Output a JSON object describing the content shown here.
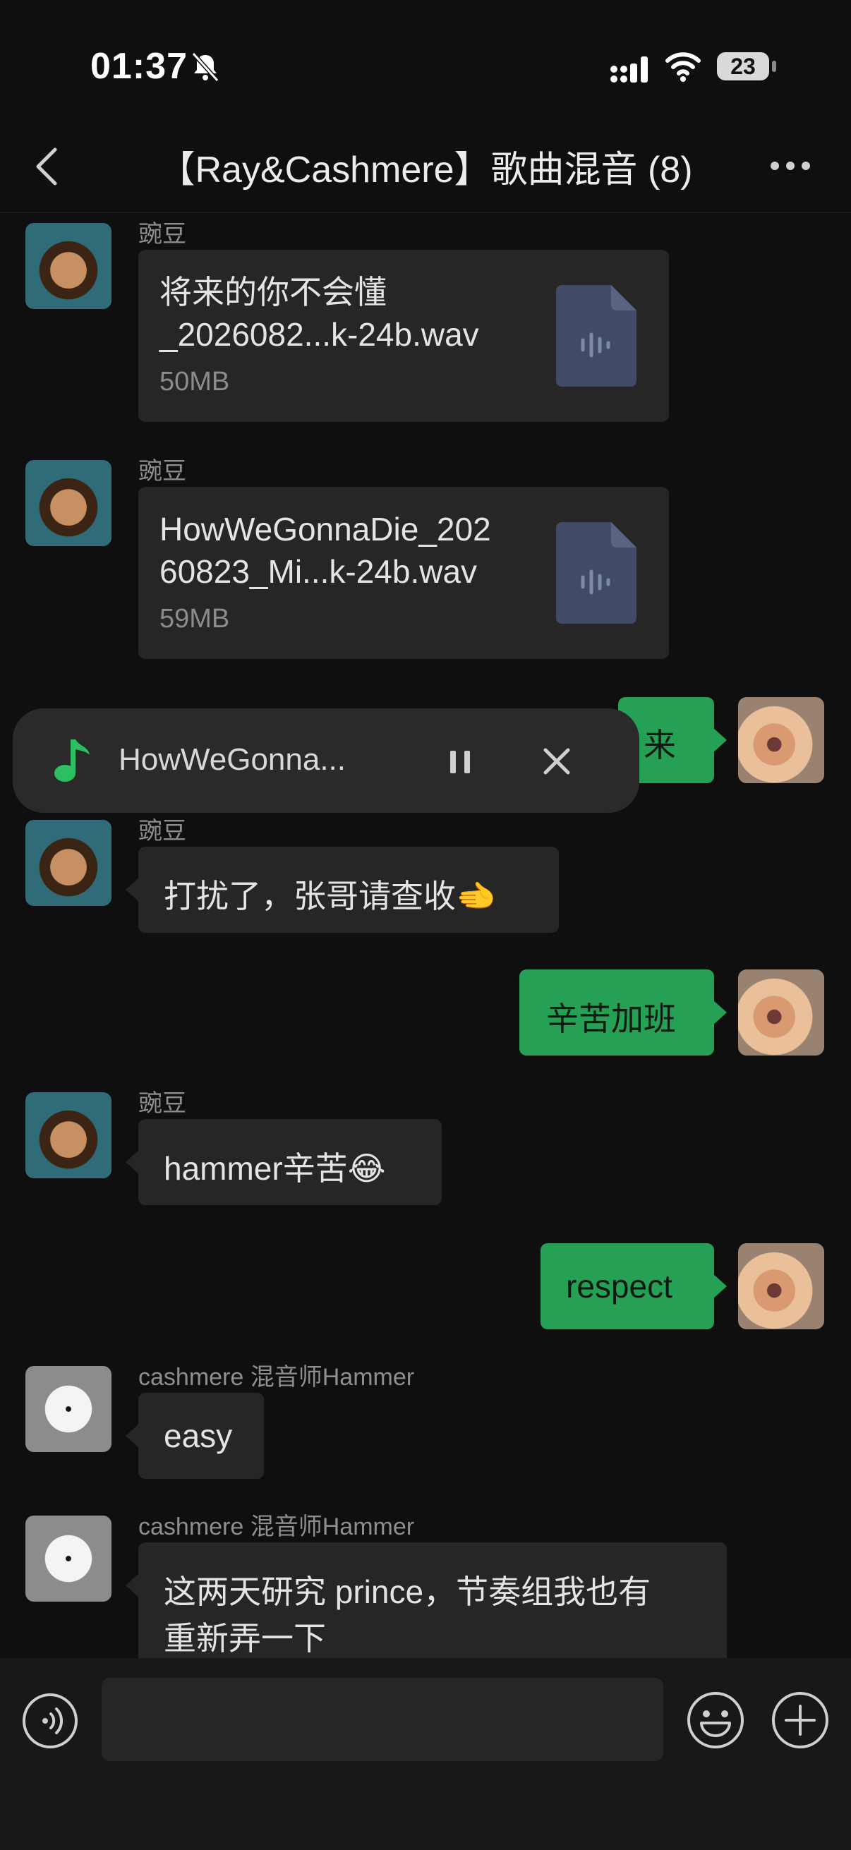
{
  "status_bar": {
    "time": "01:37",
    "battery": "23"
  },
  "header": {
    "title": "【Ray&Cashmere】歌曲混音 (8)"
  },
  "messages": {
    "m1": {
      "sender": "豌豆",
      "file_name_line1": "将来的你不会懂",
      "file_name_line2": "_2026082...k-24b.wav",
      "file_size": "50MB"
    },
    "m2": {
      "sender": "豌豆",
      "file_name_line1": "HowWeGonnaDie_202",
      "file_name_line2": "60823_Mi...k-24b.wav",
      "file_size": "59MB"
    },
    "m3": {
      "text": "来"
    },
    "m4": {
      "sender": "豌豆",
      "text": "打扰了，张哥请查收🫲"
    },
    "m5": {
      "text": "辛苦加班"
    },
    "m6": {
      "sender": "豌豆",
      "text": "hammer辛苦😂"
    },
    "m7": {
      "text": "respect"
    },
    "m8": {
      "sender": "cashmere 混音师Hammer",
      "text": "easy"
    },
    "m9": {
      "sender": "cashmere 混音师Hammer",
      "text_line1": "这两天研究 prince，节奏组我也有",
      "text_line2": "重新弄一下"
    }
  },
  "player": {
    "title": "HowWeGonna..."
  },
  "colors": {
    "accent_green": "#26a055",
    "bubble_in": "#262626",
    "background": "#0f0f0f"
  },
  "icons": {
    "back": "chevron-left-icon",
    "more": "more-icon",
    "bell": "muted-bell-icon",
    "file": "audio-file-icon",
    "music": "music-note-icon",
    "pause": "pause-icon",
    "close": "close-icon",
    "voice": "voice-icon",
    "emoji": "emoji-icon",
    "add": "add-icon"
  }
}
